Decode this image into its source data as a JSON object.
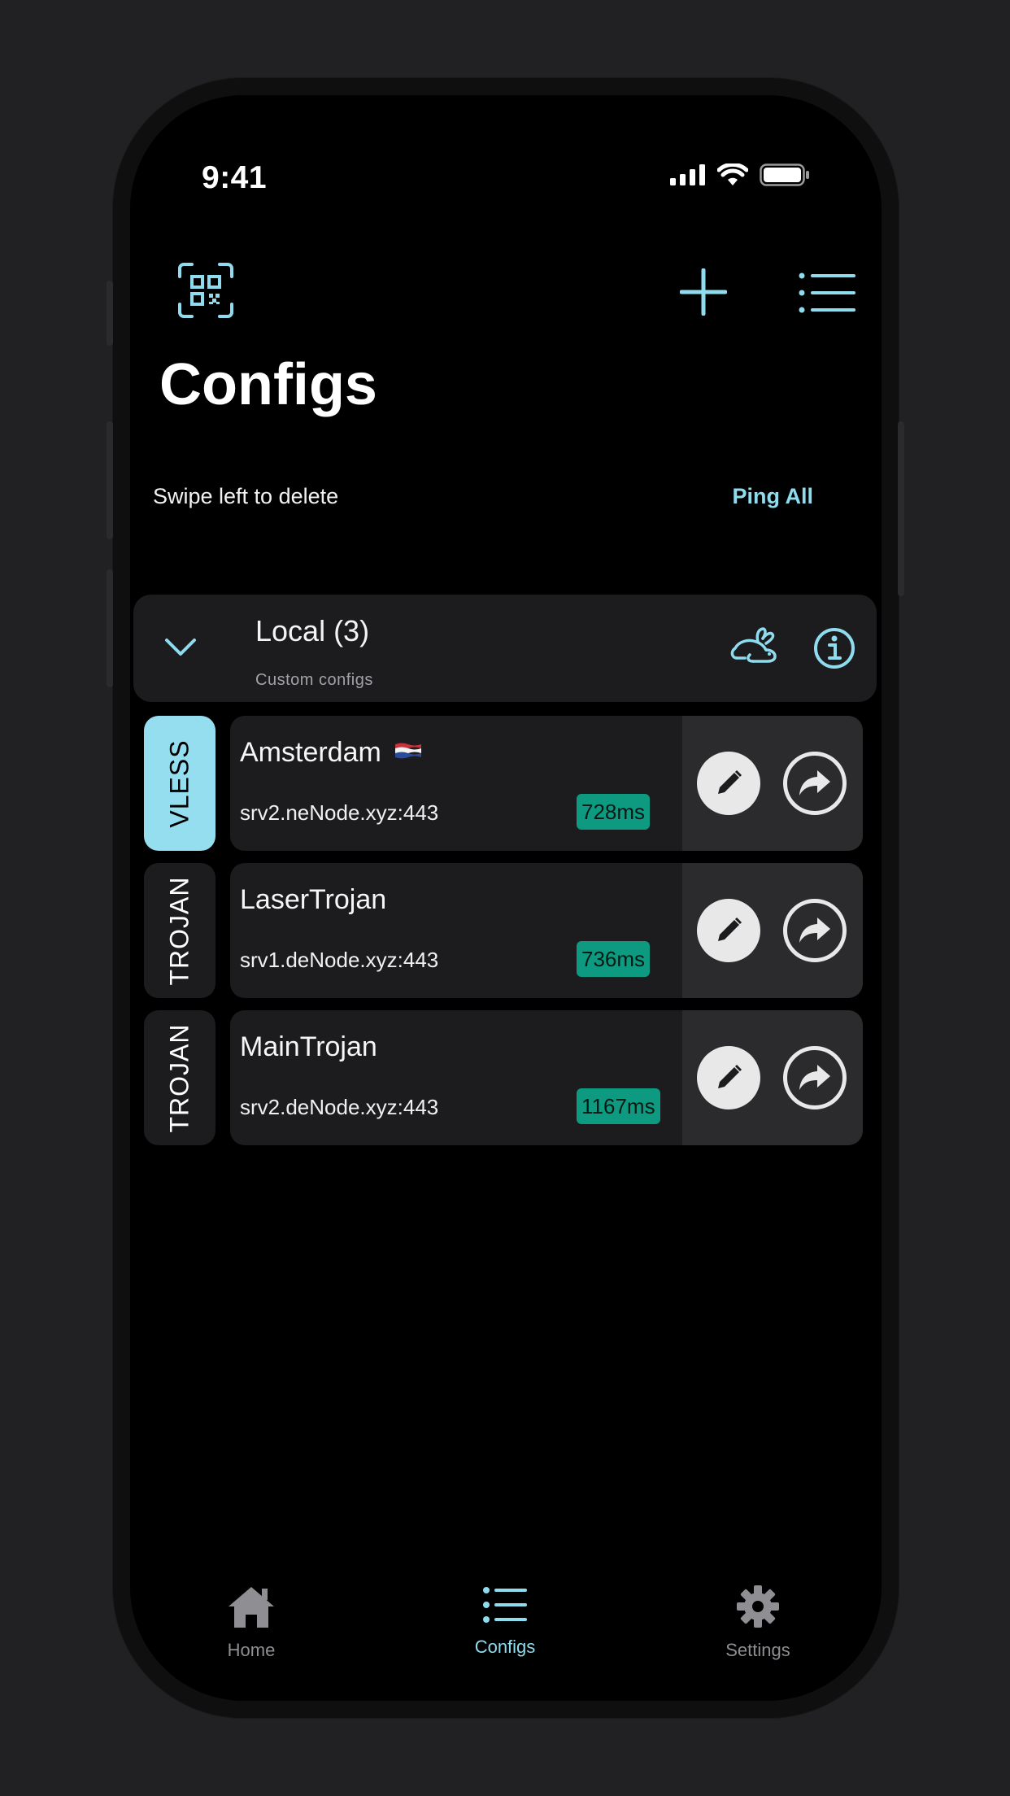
{
  "status_bar": {
    "time": "9:41"
  },
  "header": {
    "title": "Configs",
    "scan_icon": "qr-scan-icon",
    "add_icon": "plus-icon",
    "list_icon": "list-icon"
  },
  "list_controls": {
    "hint": "Swipe left to delete",
    "ping_all": "Ping All"
  },
  "group": {
    "title": "Local (3)",
    "subtitle": "Custom configs"
  },
  "configs": [
    {
      "protocol": "VLESS",
      "name": "Amsterdam",
      "host": "srv2.neNode.xyz:443",
      "ping": "728ms",
      "active": true
    },
    {
      "protocol": "TROJAN",
      "name": "LaserTrojan",
      "host": "srv1.deNode.xyz:443",
      "ping": "736ms",
      "active": false
    },
    {
      "protocol": "TROJAN",
      "name": "MainTrojan",
      "host": "srv2.deNode.xyz:443",
      "ping": "1167ms",
      "active": false
    }
  ],
  "tabbar": {
    "home": "Home",
    "configs": "Configs",
    "settings": "Settings"
  },
  "colors": {
    "accent": "#8fdcee",
    "ping_badge": "#0d9a80",
    "card": "#1c1c1e",
    "background": "#000000"
  }
}
